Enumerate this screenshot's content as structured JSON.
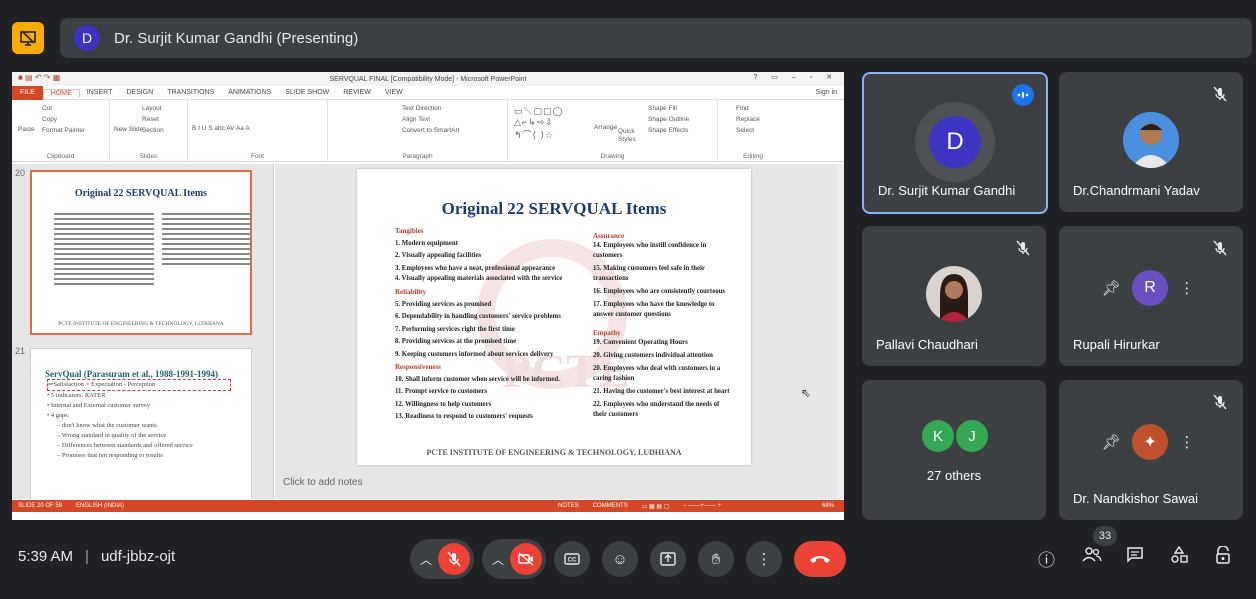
{
  "presenter_bar": {
    "avatar_letter": "D",
    "title": "Dr. Surjit Kumar Gandhi (Presenting)"
  },
  "ppt": {
    "window_title": "SERVQUAL FINAL [Compatibility Mode] - Microsoft PowerPoint",
    "tabs": [
      "FILE",
      "HOME",
      "INSERT",
      "DESIGN",
      "TRANSITIONS",
      "ANIMATIONS",
      "SLIDE SHOW",
      "REVIEW",
      "VIEW"
    ],
    "sign_in": "Sign in",
    "ribbon_groups": [
      {
        "label": "Clipboard",
        "items": [
          "Cut",
          "Copy",
          "Paste",
          "Format Painter"
        ]
      },
      {
        "label": "Slides",
        "items": [
          "Layout",
          "Reset",
          "New Slide",
          "Section"
        ]
      },
      {
        "label": "Font",
        "items": [
          "B  I  U  S  abc  AV  Aa  A"
        ]
      },
      {
        "label": "Paragraph",
        "items": [
          "Text Direction",
          "Align Text",
          "Convert to SmartArt"
        ]
      },
      {
        "label": "Drawing",
        "items": [
          "Arrange",
          "Quick Styles",
          "Shape Fill",
          "Shape Outline",
          "Shape Effects"
        ]
      },
      {
        "label": "Editing",
        "items": [
          "Find",
          "Replace",
          "Select"
        ]
      }
    ],
    "thumb20": {
      "number": "20",
      "title": "Original 22 SERVQUAL Items",
      "footer": "PCTE INSTITUTE OF ENGINEERING & TECHNOLOGY, LUDHIANA"
    },
    "thumb21": {
      "number": "21",
      "title": "ServQual (Parasuram et al., 1988-1991-1994)",
      "lines": [
        "⇒Satisfaction = Expectation - Perception",
        "• 5 indicators: RATER",
        "• Internal and External customer survey",
        "• 4 gaps:",
        "– don't know what the customer wants",
        "– Wrong standard in quality of the service",
        "– Differences between standards and offered service",
        "– Promises that not responding to results"
      ]
    },
    "slide": {
      "title": "Original 22 SERVQUAL Items",
      "left_column": [
        {
          "type": "hd",
          "text": "Tangibles"
        },
        {
          "type": "it",
          "text": "1. Modern equipment"
        },
        {
          "type": "it",
          "text": "2. Visually appealing facilities"
        },
        {
          "type": "it",
          "text": "3. Employees who have a neat, professional appearance"
        },
        {
          "type": "it",
          "text": "4. Visually appealing materials associated with the service"
        },
        {
          "type": "hd",
          "text": "Reliability"
        },
        {
          "type": "it",
          "text": "5. Providing services as promised"
        },
        {
          "type": "it",
          "text": "6. Dependability in handling customers' service problems"
        },
        {
          "type": "it",
          "text": "7. Performing services right the first time"
        },
        {
          "type": "it",
          "text": "8. Providing services at the promised time"
        },
        {
          "type": "it",
          "text": "9. Keeping customers informed about services delivery"
        },
        {
          "type": "hd",
          "text": "Responsiveness"
        },
        {
          "type": "it",
          "text": "10. Shall inform customer when service will be informed."
        },
        {
          "type": "it",
          "text": "11. Prompt service to customers"
        },
        {
          "type": "it",
          "text": "12. Willingness to help customers"
        },
        {
          "type": "it",
          "text": "13. Readiness to respond to customers' requests"
        }
      ],
      "right_column": [
        {
          "type": "hd",
          "text": "Assurance"
        },
        {
          "type": "it",
          "text": "14. Employees who instill confidence in customers"
        },
        {
          "type": "it",
          "text": "15. Making customers feel safe in their transactions"
        },
        {
          "type": "it",
          "text": "16. Employees who are consistently courteous"
        },
        {
          "type": "it",
          "text": "17. Employees who have the knowledge to answer customer questions"
        },
        {
          "type": "hd",
          "text": "Empathy"
        },
        {
          "type": "it",
          "text": "19. Convenient Operating Hours"
        },
        {
          "type": "it",
          "text": "20. Giving customers individual attention"
        },
        {
          "type": "it",
          "text": "20. Employees who deal with customers in a caring fashion"
        },
        {
          "type": "it",
          "text": "21. Having the customer's best interest at heart"
        },
        {
          "type": "it",
          "text": "22. Employees who understand the needs of their customers"
        }
      ],
      "footer": "PCTE INSTITUTE OF ENGINEERING & TECHNOLOGY, LUDHIANA",
      "watermark": "PCTE"
    },
    "notes_placeholder": "Click to add notes",
    "status": {
      "slide": "SLIDE 20 OF 59",
      "language": "ENGLISH (INDIA)",
      "notes": "NOTES",
      "comments": "COMMENTS",
      "zoom": "68%"
    }
  },
  "participants": [
    {
      "name": "Dr. Surjit Kumar Gandhi",
      "avatar": "D"
    },
    {
      "name": "Dr.Chandrmani Yadav"
    },
    {
      "name": "Pallavi Chaudhari"
    },
    {
      "name": "Rupali Hirurkar",
      "avatar": "R"
    },
    {
      "name": "27 others",
      "avatars": [
        "K",
        "J"
      ]
    },
    {
      "name": "Dr. Nandkishor Sawai"
    }
  ],
  "bottom": {
    "time": "5:39 AM",
    "meeting_code": "udf-jbbz-ojt",
    "participant_count": "33"
  },
  "colors": {
    "meet_bg": "#202124",
    "tile_bg": "#3c4043",
    "ppt_accent": "#d24726",
    "danger": "#ea4335",
    "active_border": "#8ab4f8"
  }
}
